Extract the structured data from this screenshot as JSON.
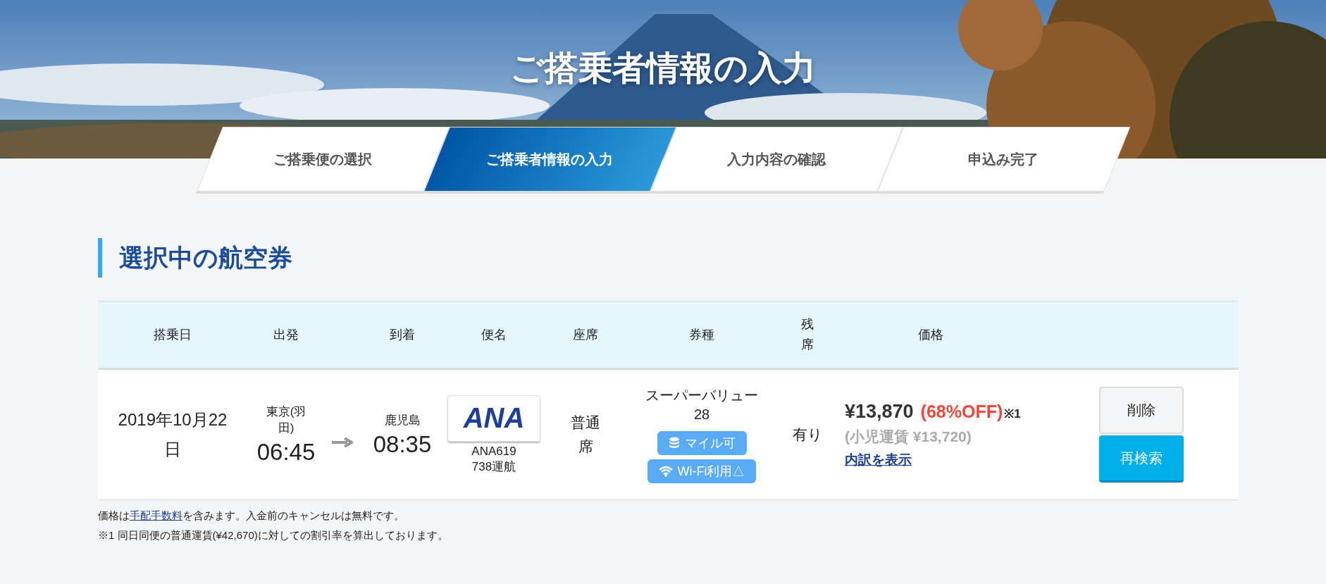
{
  "page_title": "ご搭乗者情報の入力",
  "steps": [
    {
      "label": "ご搭乗便の選択",
      "selected": false
    },
    {
      "label": "ご搭乗者情報の入力",
      "selected": true
    },
    {
      "label": "入力内容の確認",
      "selected": false
    },
    {
      "label": "申込み完了",
      "selected": false
    }
  ],
  "section_title": "選択中の航空券",
  "table": {
    "columns": [
      "搭乗日",
      "出発",
      "到着",
      "便名",
      "座席",
      "券種",
      "残席",
      "価格"
    ],
    "rows": [
      {
        "date": "2019年10月22日",
        "departure_place": "東京(羽田)",
        "departure_time": "06:45",
        "arrival_place": "鹿児島",
        "arrival_time": "08:35",
        "airline_logo": "ANA",
        "flight": "ANA619",
        "operation": "738運航",
        "seat": "普通席",
        "fare_type": "スーパーバリュー28",
        "tags": [
          {
            "kind": "miles",
            "label": "マイル可"
          },
          {
            "kind": "wifi",
            "label": "Wi-Fi利用△"
          }
        ],
        "seats_left": "有り",
        "price": "¥13,870",
        "discount": "(68%OFF)",
        "note_mark": "※1",
        "child_price": "(小児運賃 ¥13,720)",
        "breakdown_link": "内訳を表示",
        "buttons": [
          {
            "kind": "delete",
            "label": "削除"
          },
          {
            "kind": "research",
            "label": "再検索"
          }
        ]
      }
    ]
  },
  "notes": [
    {
      "before": "価格は",
      "link": "手配手数料",
      "after": "を含みます。入金前のキャンセルは無料です。"
    },
    {
      "before": "※1 同日同便の普通運賃(¥42,670)に対しての割引率を算出しております。"
    }
  ]
}
